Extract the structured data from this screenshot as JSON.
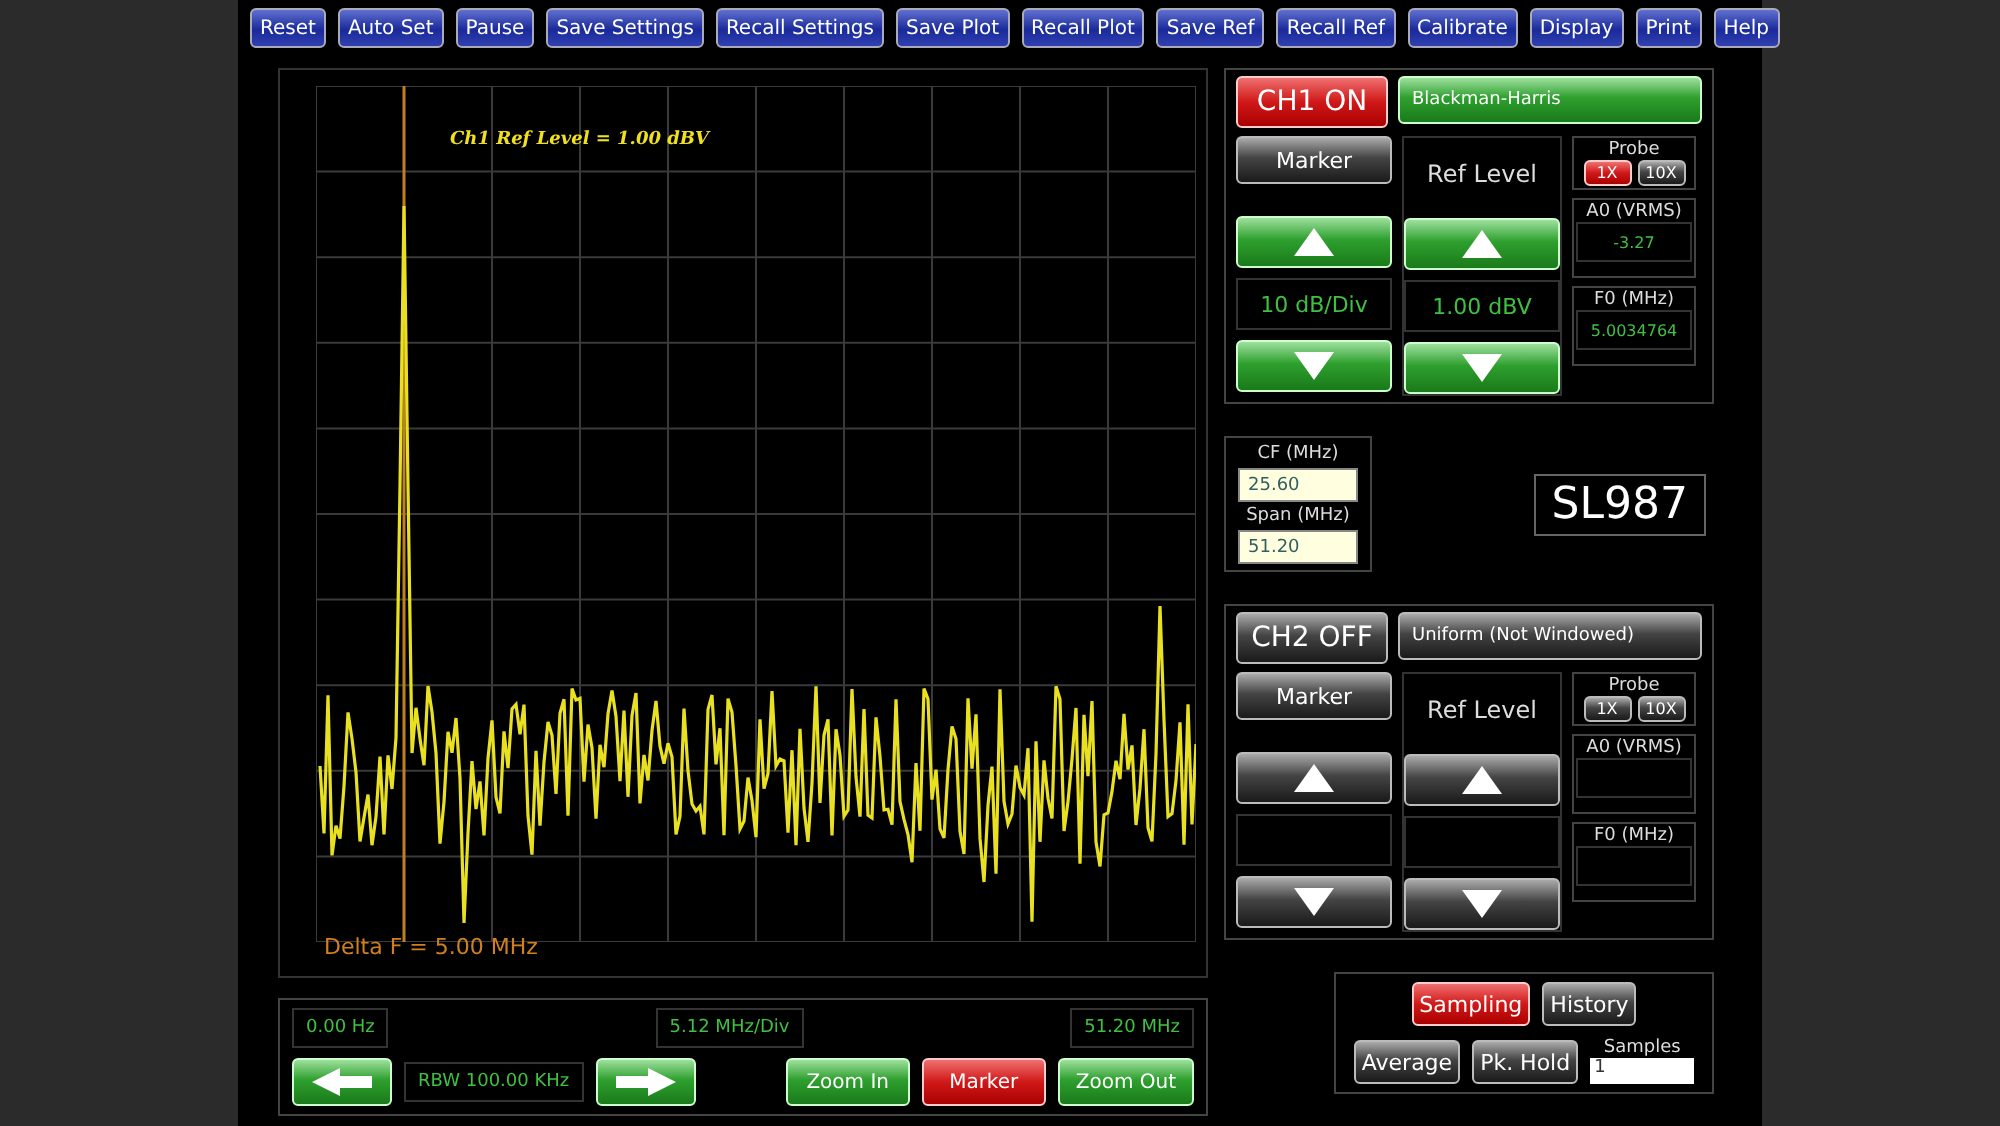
{
  "toolbar": [
    {
      "label": "Reset"
    },
    {
      "label": "Auto Set"
    },
    {
      "label": "Pause"
    },
    {
      "label": "Save Settings"
    },
    {
      "label": "Recall Settings"
    },
    {
      "label": "Save Plot"
    },
    {
      "label": "Recall Plot"
    },
    {
      "label": "Save Ref"
    },
    {
      "label": "Recall Ref"
    },
    {
      "label": "Calibrate"
    },
    {
      "label": "Display"
    },
    {
      "label": "Print"
    },
    {
      "label": "Help"
    }
  ],
  "plot": {
    "ref_label": "Ch1 Ref Level = 1.00 dBV",
    "delta_label": "Delta F = 5.00 MHz"
  },
  "axis": {
    "start": "0.00 Hz",
    "per_div": "5.12 MHz/Div",
    "end": "51.20 MHz",
    "rbw": "RBW 100.00 KHz"
  },
  "plot_buttons": [
    {
      "label": "Zoom In",
      "active": false
    },
    {
      "label": "Marker",
      "active": true
    },
    {
      "label": "Zoom Out",
      "active": false
    }
  ],
  "channels": [
    {
      "name": "CH1 ON",
      "on": true,
      "window": "Blackman-Harris",
      "marker": "Marker",
      "ref_level": "Ref Level",
      "scale": "10 dB/Div",
      "ref_value": "1.00 dBV",
      "probe": {
        "title": "Probe",
        "options": [
          {
            "label": "1X",
            "selected": true
          },
          {
            "label": "10X",
            "selected": false
          }
        ]
      },
      "a0_label": "A0 (VRMS)",
      "a0_value": "-3.27",
      "f0_label": "F0 (MHz)",
      "f0_value": "5.0034764"
    },
    {
      "name": "CH2 OFF",
      "on": false,
      "window": "Uniform (Not Windowed)",
      "marker": "Marker",
      "ref_level": "Ref Level",
      "probe": {
        "title": "Probe",
        "options": [
          {
            "label": "1X",
            "selected": false
          },
          {
            "label": "10X",
            "selected": false
          }
        ]
      },
      "a0_label": "A0 (VRMS)",
      "f0_label": "F0 (MHz)"
    }
  ],
  "frequency": {
    "cf_label": "CF (MHz)",
    "cf_value": "25.60",
    "span_label": "Span (MHz)",
    "span_value": "51.20"
  },
  "device": "SL987",
  "acquisition": {
    "modes": [
      {
        "label": "Sampling",
        "selected": true
      },
      {
        "label": "History",
        "selected": false
      }
    ],
    "buttons": [
      "Average",
      "Pk. Hold"
    ],
    "samples_label": "Samples",
    "samples_value": "1"
  }
}
